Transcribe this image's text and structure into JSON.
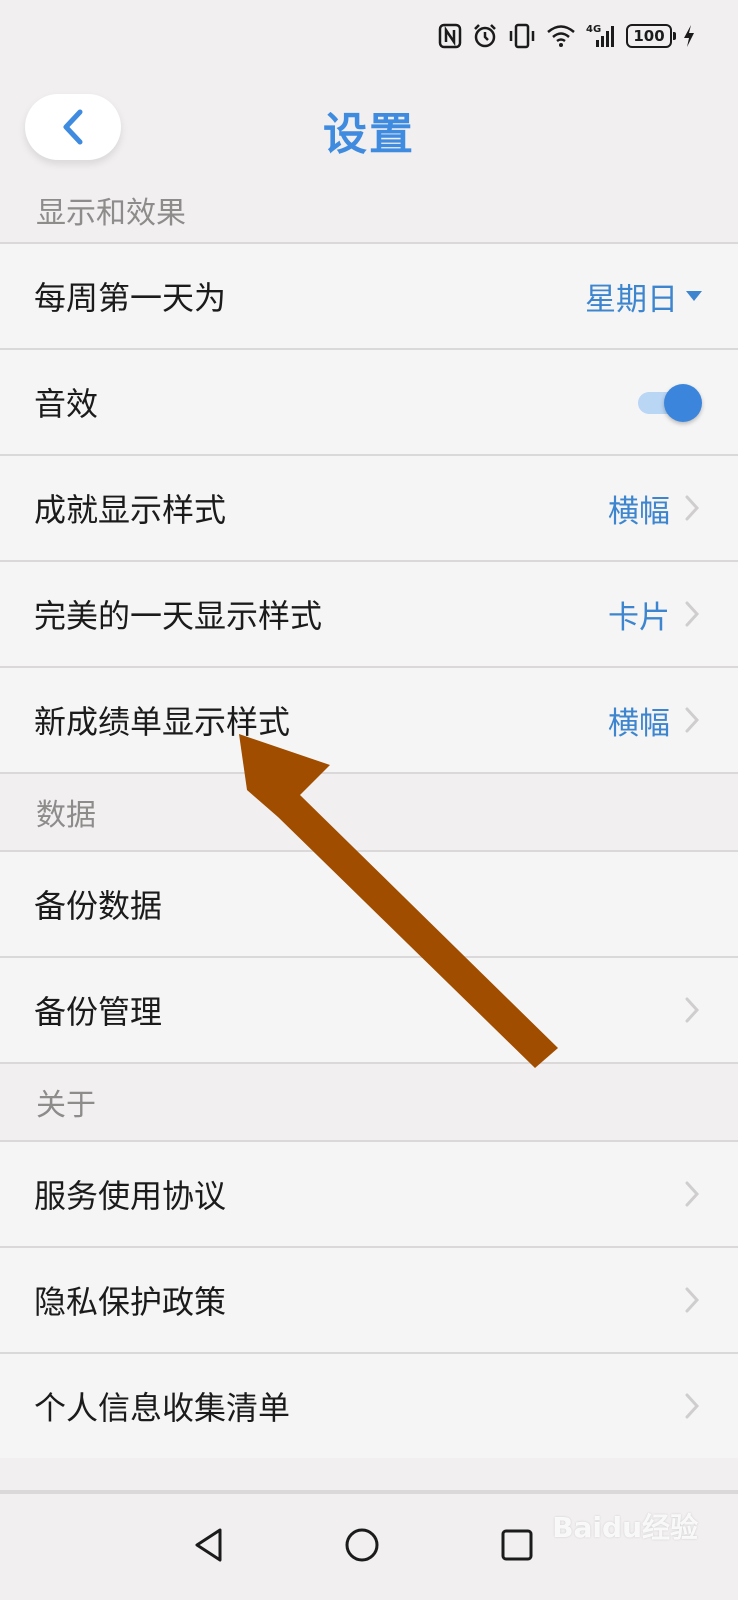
{
  "status_bar": {
    "battery": "100",
    "network": "4G",
    "icons": [
      "nfc-icon",
      "alarm-icon",
      "vibrate-icon",
      "wifi-icon",
      "signal-icon",
      "battery-icon",
      "charging-icon"
    ]
  },
  "header": {
    "title": "设置",
    "back_icon": "chevron-left-icon"
  },
  "sections": {
    "display": {
      "title": "显示和效果",
      "items": [
        {
          "label": "每周第一天为",
          "value": "星期日"
        },
        {
          "label": "音效",
          "toggle": true
        },
        {
          "label": "成就显示样式",
          "value": "横幅"
        },
        {
          "label": "完美的一天显示样式",
          "value": "卡片"
        },
        {
          "label": "新成绩单显示样式",
          "value": "横幅"
        }
      ]
    },
    "data": {
      "title": "数据",
      "items": [
        {
          "label": "备份数据"
        },
        {
          "label": "备份管理"
        }
      ]
    },
    "about": {
      "title": "关于",
      "items": [
        {
          "label": "服务使用协议"
        },
        {
          "label": "隐私保护政策"
        },
        {
          "label": "个人信息收集清单"
        }
      ]
    }
  },
  "nav_bar": {
    "icons": [
      "back-triangle-icon",
      "home-circle-icon",
      "recents-square-icon"
    ]
  },
  "watermark": "Baidu经验",
  "colors": {
    "accent": "#3f8be0",
    "value_text": "#3d86cf",
    "annotation_arrow": "#a04d00"
  }
}
